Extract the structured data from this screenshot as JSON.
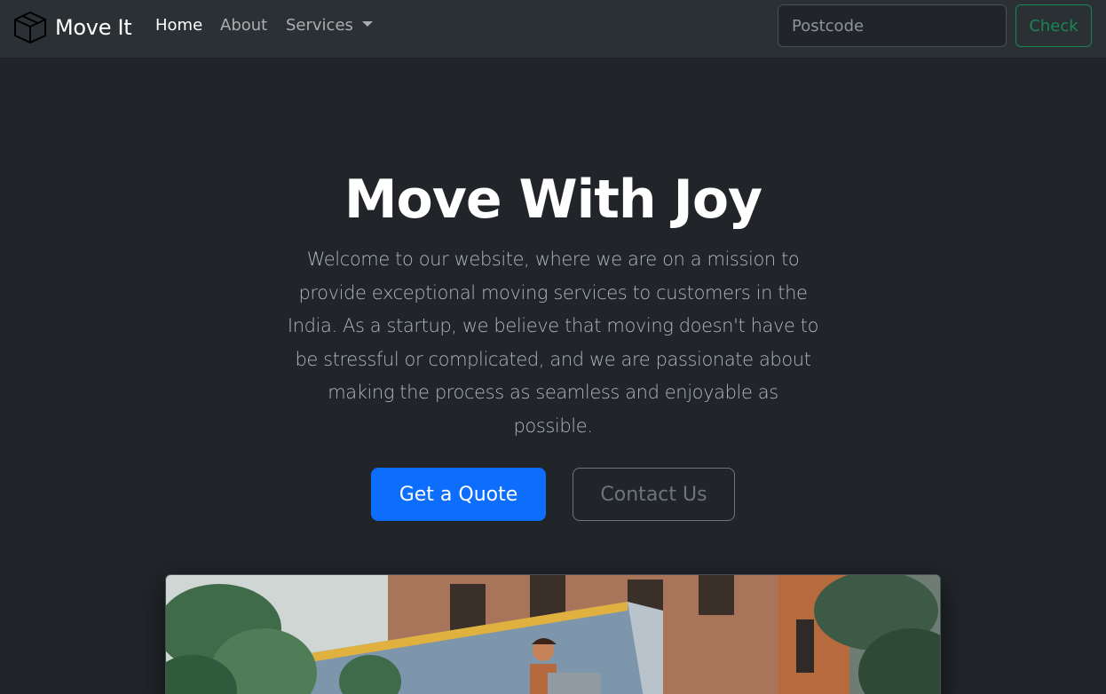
{
  "navbar": {
    "brand": "Move It",
    "brand_icon": "box-icon",
    "links": {
      "home": "Home",
      "about": "About",
      "services": "Services"
    },
    "search": {
      "placeholder": "Postcode",
      "value": ""
    },
    "check_label": "Check"
  },
  "hero": {
    "title": "Move With Joy",
    "lead": "Welcome to our website, where we are on a mission to provide exceptional moving services to customers in the India. As a startup, we believe that moving doesn't have to be stressful or complicated, and we are passionate about making the process as seamless and enjoyable as possible.",
    "primary_button": "Get a Quote",
    "secondary_button": "Contact Us"
  },
  "colors": {
    "background": "#212529",
    "navbar": "#2b3035",
    "primary": "#0d6efd",
    "success": "#198754",
    "secondary": "#6c757d"
  }
}
